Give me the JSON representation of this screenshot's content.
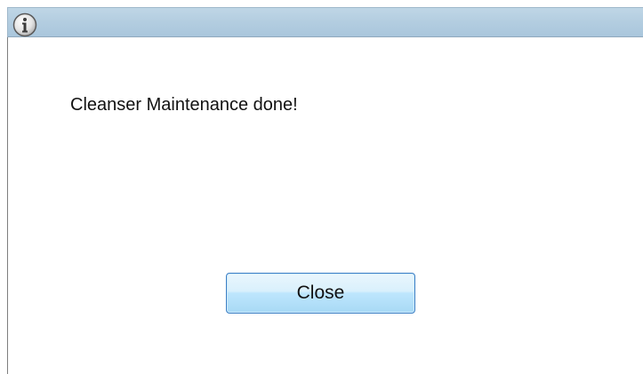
{
  "dialog": {
    "title_icon": "info-icon",
    "message": "Cleanser Maintenance done!",
    "close_label": "Close"
  },
  "colors": {
    "title_bar": "#b3cde0",
    "button_border": "#3b7fc4",
    "button_fill": "#bee6fd"
  }
}
